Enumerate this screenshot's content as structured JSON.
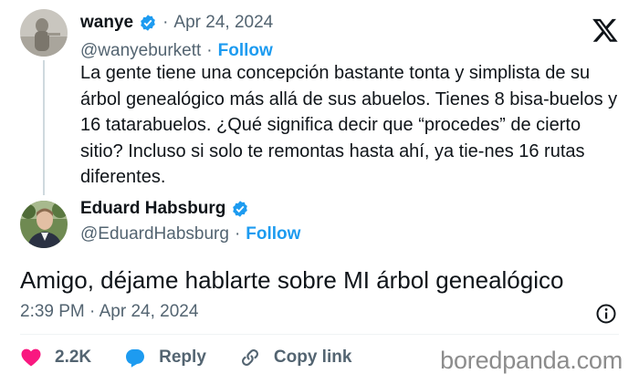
{
  "quoted_tweet": {
    "author_name": "wanye",
    "date": "Apr 24, 2024",
    "handle": "@wanyeburkett",
    "follow_label": "Follow",
    "text": "La gente  tiene una concepción bastante tonta y simplista de su árbol genealógico más allá de sus abuelos. Tienes 8 bisa-buelos y 16 tatarabuelos. ¿Qué significa decir que “procedes” de cierto sitio? Incluso si solo te remontas hasta ahí, ya tie-nes 16 rutas diferentes."
  },
  "reply_tweet": {
    "author_name": "Eduard Habsburg",
    "handle": "@EduardHabsburg",
    "follow_label": "Follow",
    "text": "Amigo, déjame hablarte sobre MI árbol genealógico",
    "timestamp": "2:39 PM · Apr 24, 2024"
  },
  "actions": {
    "like_count": "2.2K",
    "reply_label": "Reply",
    "copy_link_label": "Copy link"
  },
  "separator": "·",
  "watermark": "boredpanda.com",
  "colors": {
    "verified": "#1d9bf0",
    "link": "#1d9bf0",
    "like": "#f91880",
    "muted": "#536471"
  },
  "icons": [
    "verified-badge-icon",
    "x-logo-icon",
    "info-icon",
    "heart-icon",
    "reply-icon",
    "link-icon"
  ]
}
